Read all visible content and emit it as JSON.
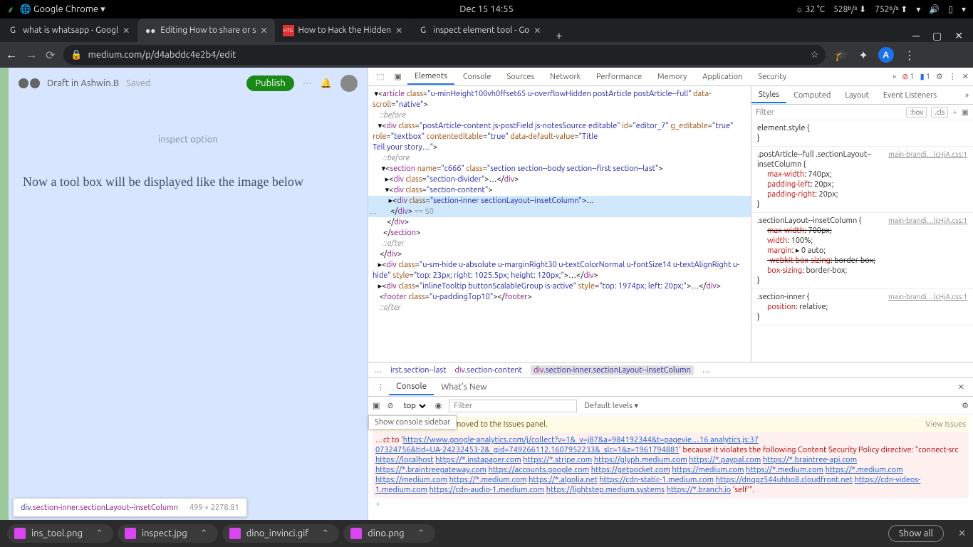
{
  "topbar": {
    "app": "Google Chrome ▾",
    "clock": "Dec 15  14:55",
    "temp": "32 °C",
    "down": "528ᵇ/ˢ",
    "up": "752ᵇ/ˢ"
  },
  "tabs": [
    {
      "title": "what is whatsapp - Googl",
      "favicon": "G"
    },
    {
      "title": "Editing How to share or s",
      "favicon": "●●"
    },
    {
      "title": "How to Hack the Hidden",
      "favicon": "HTG"
    },
    {
      "title": "inspect element tool - Go",
      "favicon": "G"
    }
  ],
  "omnibox": {
    "url": "medium.com/p/d4abddc4e2b4/edit",
    "lockIcon": "🔒"
  },
  "toolbarRight": {
    "avatar": "A"
  },
  "page": {
    "draftIn": "Draft in Ashwin.B",
    "saved": "Saved",
    "publish": "Publish",
    "inspectCaption": "inspect option",
    "body": "Now a tool box will be displayed like the image below",
    "hover": {
      "tag": "div",
      "cls": ".section-inner.sectionLayout--insetColumn",
      "dim": "499 × 2278.81"
    }
  },
  "devtools": {
    "tabs": [
      "Elements",
      "Console",
      "Sources",
      "Network",
      "Performance",
      "Memory",
      "Application",
      "Security"
    ],
    "activeTab": "Elements",
    "errors": 1,
    "infos": 1,
    "breadcrumb": [
      "…",
      "irst.section--last",
      "div.section-content",
      "div.section-inner.sectionLayout--insetColumn",
      "…"
    ],
    "stylesTabs": [
      "Styles",
      "Computed",
      "Layout",
      "Event Listeners"
    ],
    "filterPlaceholder": "Filter",
    "hov": ":hov",
    "cls": ".cls",
    "rules": [
      {
        "src": "",
        "sel": "element.style {",
        "props": [],
        "close": "}"
      },
      {
        "src": "main-brandi…lcHjA.css:1",
        "sel": ".postArticle--full .sectionLayout--insetColumn {",
        "props": [
          {
            "n": "max-width",
            "v": "740px;"
          },
          {
            "n": "padding-left",
            "v": "20px;"
          },
          {
            "n": "padding-right",
            "v": "20px;"
          }
        ],
        "close": "}"
      },
      {
        "src": "main-brandi…lcHjA.css:1",
        "sel": ".sectionLayout--insetColumn {",
        "props": [
          {
            "n": "max-width",
            "v": "700px;",
            "s": true
          },
          {
            "n": "width",
            "v": "100%;"
          },
          {
            "n": "margin",
            "v": "▸ 0 auto;"
          },
          {
            "n": "-webkit-box-sizing",
            "v": "border-box;",
            "s": true
          },
          {
            "n": "box-sizing",
            "v": "border-box;"
          }
        ],
        "close": "}"
      },
      {
        "src": "main-brandi…lcHjA.css:1",
        "sel": ".section-inner {",
        "props": [
          {
            "n": "position",
            "v": "relative;"
          }
        ],
        "close": "}"
      }
    ],
    "drawerTabs": [
      "Console",
      "What's New"
    ],
    "consoleContext": "top",
    "consoleFilter": "Filter",
    "defaultLevels": "Default levels ▾",
    "sidebarTip": "Show console sidebar",
    "warnMsg": "… matches have been moved to the Issues panel.",
    "viewIssues": "View Issues",
    "errPrefix": "…ct to '",
    "errUrl1": "https://www.google-analytics.com/j/collect?v=1&_v=j87&a=984192344&t=pagevie…16 analytics.js:37",
    "errUrl1b": "07324756&tid=UA-24232453-2&_gid=749266112.1607952233&_slc=1&z=1961794881",
    "errMid": "' because it violates the following Content Security Policy directive: \"connect-src ",
    "errUrls": [
      "https://localhost",
      "https://*.instapaper.com",
      "https://*.stripe.com",
      "https://glyph.medium.com",
      "https://*.paypal.com",
      "https://*.braintree-api.com",
      "https://*.braintreegateway.com",
      "https://accounts.google.com",
      "https://getpocket.com",
      "https://medium.com",
      "https://*.medium.com",
      "https://*.medium.com",
      "https://medium.com",
      "https://*.medium.com",
      "https://*.algolia.net",
      "https://cdn-static-1.medium.com",
      "https://dnqgz544uhbo8.cloudfront.net",
      "https://cdn-videos-1.medium.com",
      "https://cdn-audio-1.medium.com",
      "https://lightstep.medium.systems",
      "https://*.branch.io"
    ],
    "errSuffix": " 'self'\"."
  },
  "downloads": {
    "items": [
      "ins_tool.png",
      "inspect.jpg",
      "dino_invinci.gif",
      "dino.png"
    ],
    "showAll": "Show all"
  }
}
